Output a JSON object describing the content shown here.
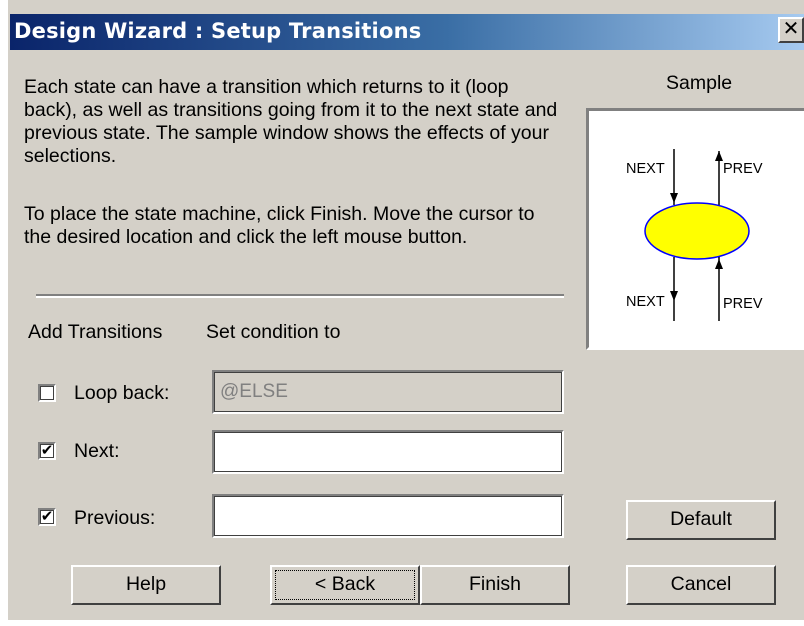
{
  "window": {
    "title": "Design Wizard : Setup Transitions",
    "close_glyph": "✕"
  },
  "description": {
    "paragraph1": "Each state can have a transition which returns to it (loop back), as well as transitions going from it to the next state and previous state.  The sample window shows the effects of your selections.",
    "paragraph2": "To place the state machine, click Finish.  Move the cursor to the desired location and click the left mouse button."
  },
  "sample": {
    "label": "Sample",
    "diagram": {
      "top_left": "NEXT",
      "top_right": "PREV",
      "bottom_left": "NEXT",
      "bottom_right": "PREV",
      "state_fill": "#ffff00",
      "state_stroke": "#0000ff"
    }
  },
  "transitions": {
    "add_header": "Add Transitions",
    "condition_header": "Set condition to",
    "rows": [
      {
        "label": "Loop back:",
        "checked": false,
        "value": "@ELSE",
        "disabled": true
      },
      {
        "label": "Next:",
        "checked": true,
        "value": "",
        "disabled": false
      },
      {
        "label": "Previous:",
        "checked": true,
        "value": "",
        "disabled": false
      }
    ]
  },
  "buttons": {
    "default": "Default",
    "help": "Help",
    "back": "< Back",
    "finish": "Finish",
    "cancel": "Cancel"
  },
  "colors": {
    "dialog_bg": "#d4d0c8",
    "title_start": "#0a246a",
    "title_end": "#a6caf0"
  }
}
